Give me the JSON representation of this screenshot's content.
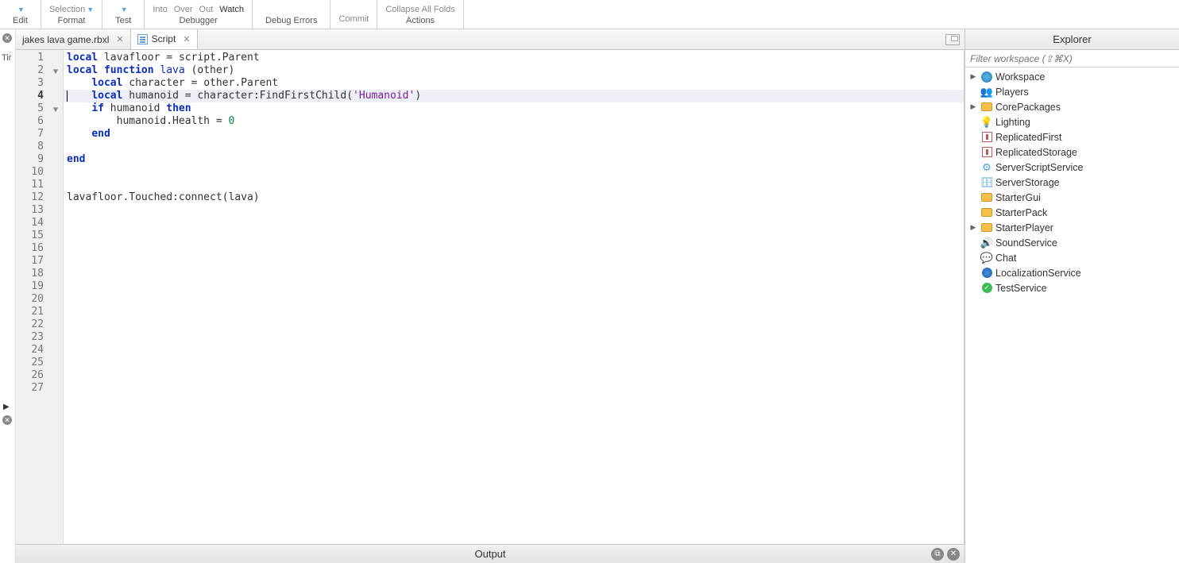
{
  "toolbar": {
    "groups": [
      {
        "label": "Edit",
        "actions": [
          {
            "t": "",
            "caret": true
          }
        ]
      },
      {
        "label": "Format",
        "actions": [
          {
            "t": "Selection",
            "caret": true
          }
        ]
      },
      {
        "label": "Test",
        "actions": [
          {
            "t": "",
            "caret": true
          }
        ]
      },
      {
        "label": "Debugger",
        "actions": [
          {
            "t": "Into"
          },
          {
            "t": "Over"
          },
          {
            "t": "Out"
          },
          {
            "t": "Watch",
            "active": true
          }
        ]
      },
      {
        "label": "Debug Errors",
        "actions": []
      },
      {
        "label": "",
        "actions": [
          {
            "t": "Commit"
          }
        ]
      },
      {
        "label": "Actions",
        "actions": [
          {
            "t": "Collapse All Folds"
          }
        ]
      }
    ]
  },
  "left_label": "Tir",
  "tabs": [
    {
      "label": "jakes lava game.rbxl",
      "active": false,
      "icon": "file"
    },
    {
      "label": "Script",
      "active": true,
      "icon": "script"
    }
  ],
  "code": {
    "current_line": 4,
    "lines": [
      {
        "n": 1,
        "fold": "",
        "html": "<span class='kw'>local</span> lavafloor = script.Parent"
      },
      {
        "n": 2,
        "fold": "▼",
        "html": "<span class='kw'>local function</span> <span class='fn'>lava</span> (other)"
      },
      {
        "n": 3,
        "fold": "",
        "html": "    <span class='kw'>local</span> character = other.Parent"
      },
      {
        "n": 4,
        "fold": "",
        "html": "<span class='cursor-bar'></span>    <span class='kw'>local</span> humanoid = character:FindFirstChild(<span class='str'>'Humanoid'</span>)"
      },
      {
        "n": 5,
        "fold": "▼",
        "html": "    <span class='kw'>if</span> humanoid <span class='kw'>then</span>"
      },
      {
        "n": 6,
        "fold": "",
        "html": "        humanoid.Health = <span class='num'>0</span>"
      },
      {
        "n": 7,
        "fold": "",
        "html": "    <span class='kw'>end</span>"
      },
      {
        "n": 8,
        "fold": "",
        "html": ""
      },
      {
        "n": 9,
        "fold": "",
        "html": "<span class='kw'>end</span>"
      },
      {
        "n": 10,
        "fold": "",
        "html": ""
      },
      {
        "n": 11,
        "fold": "",
        "html": ""
      },
      {
        "n": 12,
        "fold": "",
        "html": "lavafloor.Touched:connect(lava)"
      },
      {
        "n": 13,
        "fold": "",
        "html": ""
      },
      {
        "n": 14,
        "fold": "",
        "html": ""
      },
      {
        "n": 15,
        "fold": "",
        "html": ""
      },
      {
        "n": 16,
        "fold": "",
        "html": ""
      },
      {
        "n": 17,
        "fold": "",
        "html": ""
      },
      {
        "n": 18,
        "fold": "",
        "html": ""
      },
      {
        "n": 19,
        "fold": "",
        "html": ""
      },
      {
        "n": 20,
        "fold": "",
        "html": ""
      },
      {
        "n": 21,
        "fold": "",
        "html": ""
      },
      {
        "n": 22,
        "fold": "",
        "html": ""
      },
      {
        "n": 23,
        "fold": "",
        "html": ""
      },
      {
        "n": 24,
        "fold": "",
        "html": ""
      },
      {
        "n": 25,
        "fold": "",
        "html": ""
      },
      {
        "n": 26,
        "fold": "",
        "html": ""
      },
      {
        "n": 27,
        "fold": "",
        "html": ""
      }
    ]
  },
  "output_label": "Output",
  "explorer": {
    "title": "Explorer",
    "filter_placeholder": "Filter workspace (⇧⌘X)",
    "items": [
      {
        "label": "Workspace",
        "icon": "workspace",
        "expand": "▶",
        "indent": 0
      },
      {
        "label": "Players",
        "icon": "players",
        "expand": "",
        "indent": 0
      },
      {
        "label": "CorePackages",
        "icon": "folder",
        "expand": "▶",
        "indent": 0
      },
      {
        "label": "Lighting",
        "icon": "light",
        "expand": "",
        "indent": 0
      },
      {
        "label": "ReplicatedFirst",
        "icon": "repl",
        "expand": "",
        "indent": 0
      },
      {
        "label": "ReplicatedStorage",
        "icon": "repl",
        "expand": "",
        "indent": 0
      },
      {
        "label": "ServerScriptService",
        "icon": "server",
        "expand": "",
        "indent": 0
      },
      {
        "label": "ServerStorage",
        "icon": "storage",
        "expand": "",
        "indent": 0
      },
      {
        "label": "StarterGui",
        "icon": "folder",
        "expand": "",
        "indent": 0
      },
      {
        "label": "StarterPack",
        "icon": "folder",
        "expand": "",
        "indent": 0
      },
      {
        "label": "StarterPlayer",
        "icon": "folder",
        "expand": "▶",
        "indent": 0
      },
      {
        "label": "SoundService",
        "icon": "sound",
        "expand": "",
        "indent": 0
      },
      {
        "label": "Chat",
        "icon": "chat",
        "expand": "",
        "indent": 0
      },
      {
        "label": "LocalizationService",
        "icon": "globe",
        "expand": "",
        "indent": 0
      },
      {
        "label": "TestService",
        "icon": "check",
        "expand": "",
        "indent": 0
      }
    ]
  }
}
